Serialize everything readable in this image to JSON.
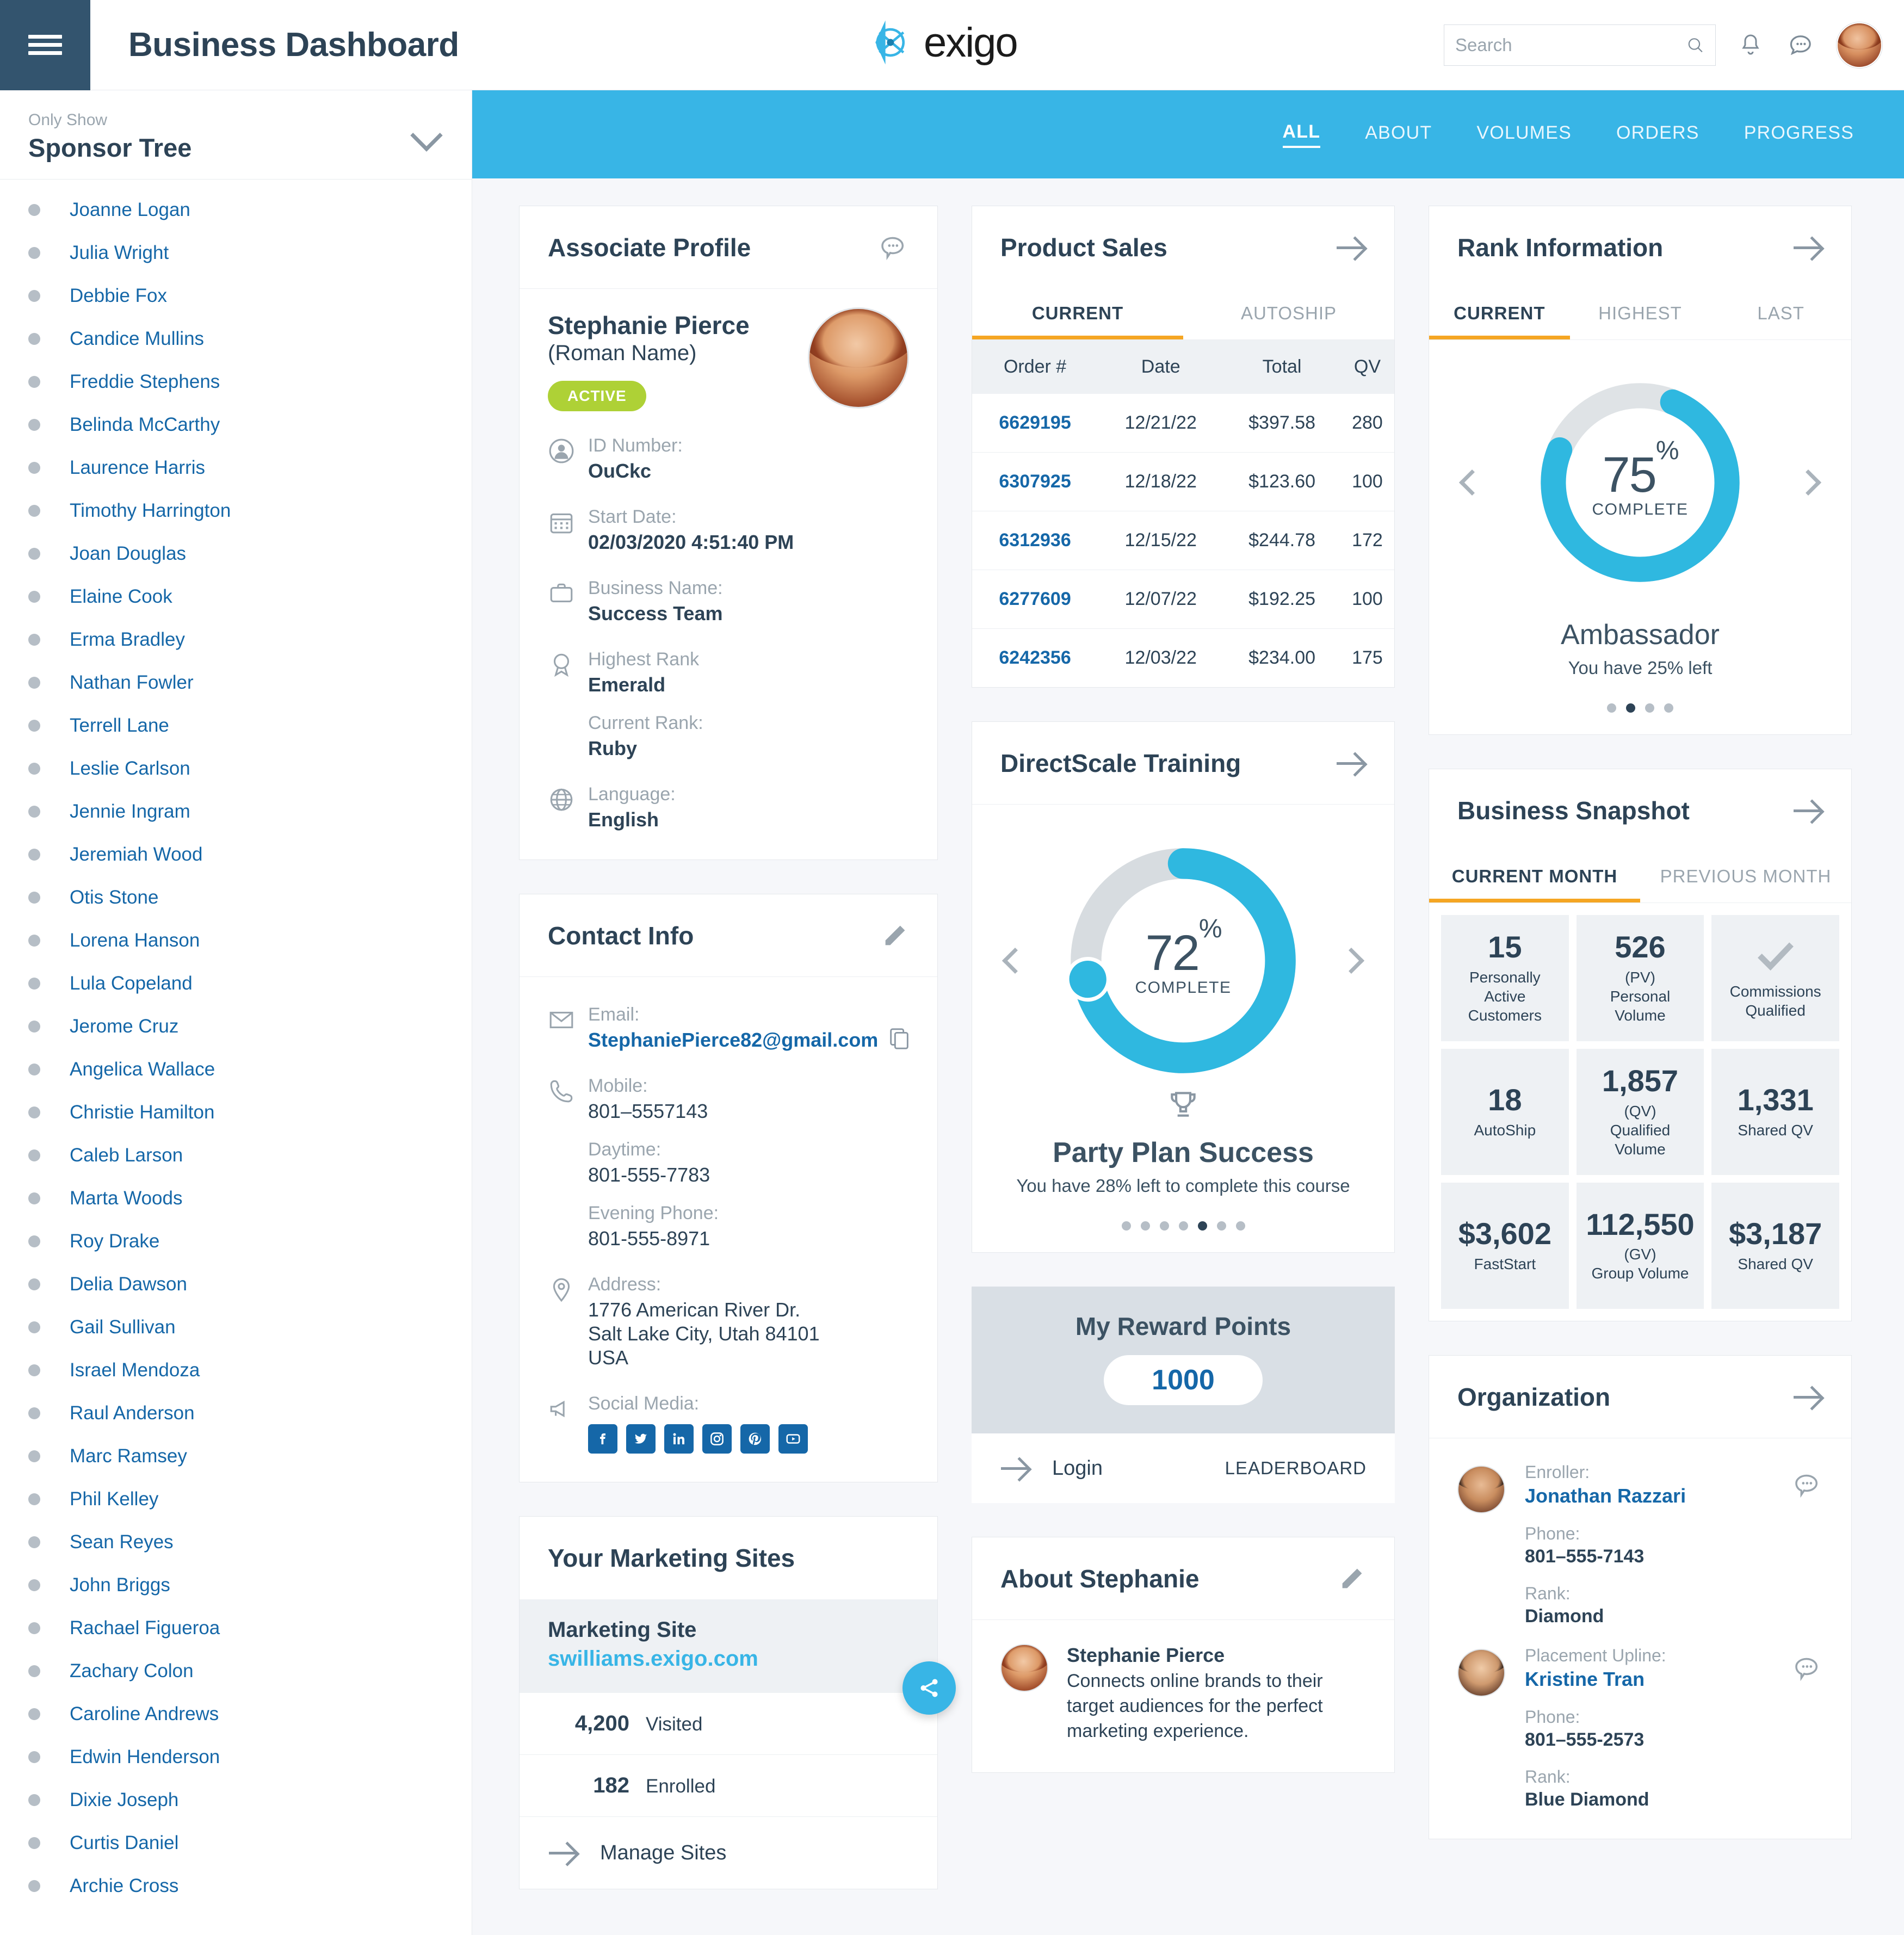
{
  "header": {
    "menu_icon": "hamburger-icon",
    "title": "Business Dashboard",
    "brand": "exigo",
    "search_placeholder": "Search",
    "search_value": "",
    "icons": [
      "search-icon",
      "bell-icon",
      "chat-icon",
      "avatar"
    ]
  },
  "topnav": {
    "tabs": [
      {
        "label": "ALL",
        "active": true
      },
      {
        "label": "ABOUT",
        "active": false
      },
      {
        "label": "VOLUMES",
        "active": false
      },
      {
        "label": "ORDERS",
        "active": false
      },
      {
        "label": "PROGRESS",
        "active": false
      }
    ]
  },
  "sidebar": {
    "only_show_label": "Only Show",
    "tree_name": "Sponsor Tree",
    "items": [
      "Joanne Logan",
      "Julia Wright",
      "Debbie Fox",
      "Candice Mullins",
      "Freddie Stephens",
      "Belinda McCarthy",
      "Laurence Harris",
      "Timothy Harrington",
      "Joan Douglas",
      "Elaine Cook",
      "Erma Bradley",
      "Nathan Fowler",
      "Terrell Lane",
      "Leslie Carlson",
      "Jennie Ingram",
      "Jeremiah Wood",
      "Otis Stone",
      "Lorena Hanson",
      "Lula Copeland",
      "Jerome Cruz",
      "Angelica Wallace",
      "Christie Hamilton",
      "Caleb Larson",
      "Marta Woods",
      "Roy Drake",
      "Delia Dawson",
      "Gail Sullivan",
      "Israel Mendoza",
      "Raul Anderson",
      "Marc Ramsey",
      "Phil Kelley",
      "Sean Reyes",
      "John Briggs",
      "Rachael Figueroa",
      "Zachary Colon",
      "Caroline Andrews",
      "Edwin Henderson",
      "Dixie Joseph",
      "Curtis Daniel",
      "Archie Cross"
    ]
  },
  "associate_profile": {
    "title": "Associate Profile",
    "name": "Stephanie Pierce",
    "roman_name": "(Roman Name)",
    "status": "ACTIVE",
    "status_color": "#aed136",
    "fields": [
      {
        "label": "ID Number:",
        "value": "OuCkc",
        "icon": "user-icon"
      },
      {
        "label": "Start Date:",
        "value": "02/03/2020 4:51:40 PM",
        "icon": "calendar-icon"
      },
      {
        "label": "Business Name:",
        "value": "Success Team",
        "icon": "briefcase-icon"
      },
      {
        "label": "Highest Rank",
        "value": "Emerald",
        "icon": "award-icon"
      },
      {
        "label": "Current Rank:",
        "value": "Ruby",
        "icon": ""
      },
      {
        "label": "Language:",
        "value": "English",
        "icon": "globe-icon"
      }
    ]
  },
  "contact_info": {
    "title": "Contact Info",
    "email_label": "Email:",
    "email": "StephaniePierce82@gmail.com",
    "mobile_label": "Mobile:",
    "mobile": "801–5557143",
    "daytime_label": "Daytime:",
    "daytime": "801-555-7783",
    "evening_label": "Evening Phone:",
    "evening": "801-555-8971",
    "address_label": "Address:",
    "address_line1": "1776 American River Dr.",
    "address_line2": "Salt Lake City, Utah 84101",
    "address_line3": "USA",
    "social_label": "Social Media:",
    "social": [
      "facebook-icon",
      "twitter-icon",
      "linkedin-icon",
      "instagram-icon",
      "pinterest-icon",
      "youtube-icon"
    ]
  },
  "marketing_sites": {
    "title": "Your Marketing Sites",
    "site_name": "Marketing Site",
    "site_url": "swilliams.exigo.com",
    "visited_count": "4,200",
    "visited_label": "Visited",
    "enrolled_count": "182",
    "enrolled_label": "Enrolled",
    "manage_label": "Manage Sites",
    "share_icon": "share-icon"
  },
  "product_sales": {
    "title": "Product Sales",
    "tabs": [
      {
        "label": "CURRENT",
        "active": true
      },
      {
        "label": "AUTOSHIP",
        "active": false
      }
    ],
    "columns": [
      "Order #",
      "Date",
      "Total",
      "QV"
    ],
    "rows": [
      {
        "order": "6629195",
        "date": "12/21/22",
        "total": "$397.58",
        "qv": "280"
      },
      {
        "order": "6307925",
        "date": "12/18/22",
        "total": "$123.60",
        "qv": "100"
      },
      {
        "order": "6312936",
        "date": "12/15/22",
        "total": "$244.78",
        "qv": "172"
      },
      {
        "order": "6277609",
        "date": "12/07/22",
        "total": "$192.25",
        "qv": "100"
      },
      {
        "order": "6242356",
        "date": "12/03/22",
        "total": "$234.00",
        "qv": "175"
      }
    ]
  },
  "training": {
    "title": "DirectScale Training",
    "percent": "72",
    "percent_symbol": "%",
    "complete_label": "COMPLETE",
    "course": "Party Plan Success",
    "note": "You have 28% left to complete this course",
    "dots_total": 7,
    "dots_active_index": 4,
    "trophy_icon": "trophy-icon",
    "accent": "#2fb8e0"
  },
  "reward_points": {
    "title": "My Reward Points",
    "points": "1000",
    "login_label": "Login",
    "leaderboard_label": "LEADERBOARD"
  },
  "about": {
    "title": "About Stephanie",
    "name": "Stephanie Pierce",
    "text": "Connects online brands to their target audiences for the perfect marketing experience."
  },
  "rank_information": {
    "title": "Rank Information",
    "tabs": [
      {
        "label": "CURRENT",
        "active": true
      },
      {
        "label": "HIGHEST",
        "active": false
      },
      {
        "label": "LAST",
        "active": false
      }
    ],
    "percent": "75",
    "percent_symbol": "%",
    "complete_label": "COMPLETE",
    "rank": "Ambassador",
    "note": "You have 25% left",
    "dots_total": 4,
    "dots_active_index": 1,
    "accent": "#2fb8e0"
  },
  "business_snapshot": {
    "title": "Business Snapshot",
    "tabs": [
      {
        "label": "CURRENT MONTH",
        "active": true
      },
      {
        "label": "PREVIOUS MONTH",
        "active": false
      }
    ],
    "cells": [
      {
        "value": "15",
        "label": "Personally\nActive\nCustomers"
      },
      {
        "value": "526",
        "label": "(PV)\nPersonal\nVolume"
      },
      {
        "value": "",
        "label": "Commissions\nQualified",
        "icon": "check-icon"
      },
      {
        "value": "18",
        "label": "AutoShip"
      },
      {
        "value": "1,857",
        "label": "(QV)\nQualified\nVolume"
      },
      {
        "value": "1,331",
        "label": "Shared QV"
      },
      {
        "value": "$3,602",
        "label": "FastStart"
      },
      {
        "value": "112,550",
        "label": "(GV)\nGroup Volume"
      },
      {
        "value": "$3,187",
        "label": "Shared QV"
      }
    ]
  },
  "organization": {
    "title": "Organization",
    "people": [
      {
        "role_label": "Enroller:",
        "name": "Jonathan Razzari",
        "phone_label": "Phone:",
        "phone": "801–555-7143",
        "rank_label": "Rank:",
        "rank": "Diamond"
      },
      {
        "role_label": "Placement Upline:",
        "name": "Kristine Tran",
        "phone_label": "Phone:",
        "phone": "801–555-2573",
        "rank_label": "Rank:",
        "rank": "Blue Diamond"
      }
    ]
  }
}
